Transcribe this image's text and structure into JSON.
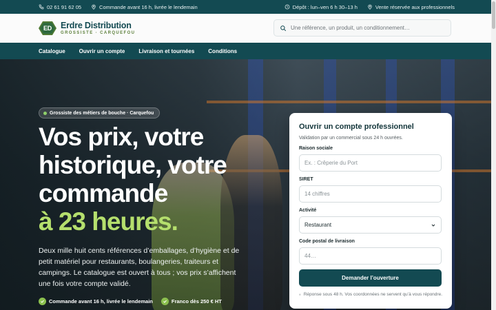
{
  "topbar": {
    "phone": "02 61 91 62 05",
    "order_note": "Commande avant 16 h, livrée le lendemain",
    "depot_hours": "Dépôt : lun–ven 6 h 30–13 h",
    "pro_sale": "Vente réservée aux professionnels"
  },
  "header": {
    "logo_initials": "ED",
    "brand_name": "Erdre Distribution",
    "brand_tagline": "GROSSISTE · CARQUEFOU",
    "search_placeholder": "Une référence, un produit, un conditionnement…"
  },
  "nav": {
    "items": [
      "Catalogue",
      "Ouvrir un compte",
      "Livraison et tournées",
      "Conditions"
    ]
  },
  "hero": {
    "badge": "Grossiste des métiers de bouche · Carquefou",
    "headline_lines": [
      "Vos prix, votre",
      "historique, votre",
      "commande"
    ],
    "headline_highlight": "à 23 heures.",
    "lead": "Deux mille huit cents références d’emballages, d’hygiène et de petit matériel pour restaurants, boulangeries, traiteurs et campings. Le catalogue est ouvert à tous ; vos prix s’affichent une fois votre compte validé.",
    "checks": [
      "Commande avant 16 h, livrée le lendemain",
      "Franco dès 250 € HT"
    ]
  },
  "form": {
    "title": "Ouvrir un compte professionnel",
    "subtitle": "Validation par un commercial sous 24 h ouvrées.",
    "company_label": "Raison sociale",
    "company_placeholder": "Ex. : Crêperie du Port",
    "siret_label": "SIRET",
    "siret_placeholder": "14 chiffres",
    "activity_label": "Activité",
    "activity_value": "Restaurant",
    "postcode_label": "Code postal de livraison",
    "postcode_placeholder": "44…",
    "submit_label": "Demander l’ouverture",
    "privacy_note": "Réponse sous 48 h. Vos coordonnées ne servent qu’à vous répondre."
  },
  "colors": {
    "brand_dark": "#134a52",
    "accent_green": "#b5df6d",
    "check_green": "#8cc04f"
  }
}
